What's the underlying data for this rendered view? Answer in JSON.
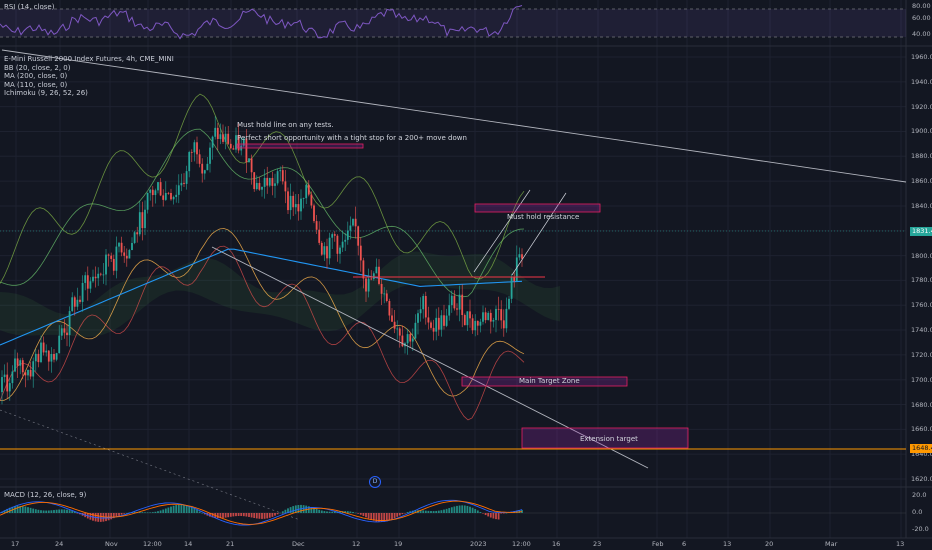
{
  "colors": {
    "background": "#131722",
    "grid": "#1e2230",
    "axis_text": "#b2b5be",
    "annotation_box": "#e91e63",
    "annotation_fill": "rgba(156,39,176,0.25)",
    "support_line": "#ff9800",
    "current_price": "#26a69a",
    "rsi_line": "#7e57c2",
    "bb_band": "#2962ff",
    "ma200": "#2196f3",
    "cloud_green": "#4caf50",
    "cloud_red": "#ef5350",
    "macd_line": "#2962ff",
    "signal_line": "#ff6d00"
  },
  "rsi": {
    "label": "RSI (14, close)",
    "ticks": [
      "80.00",
      "60.00",
      "40.00"
    ]
  },
  "legend": {
    "title": "E-Mini Russell 2000 Index Futures, 4h, CME_MINI",
    "lines": [
      "BB (20, close, 2, 0)",
      "MA (200, close, 0)",
      "MA (110, close, 0)",
      "Ichimoku (9, 26, 52, 26)"
    ]
  },
  "annotations": {
    "line1": "Must hold line on any tests.",
    "line2": "Perfect short opportunity with a tight stop for a 200+ move down",
    "resistance": "Must hold resistance",
    "main_target": "Main Target Zone",
    "extension": "Extension target",
    "event_badge": "D"
  },
  "price_axis": {
    "ticks": [
      "1960.0",
      "1940.0",
      "1920.0",
      "1900.0",
      "1880.0",
      "1860.0",
      "1840.0",
      "1820.0",
      "1800.0",
      "1780.0",
      "1760.0",
      "1740.0",
      "1720.0",
      "1700.0",
      "1680.0",
      "1660.0",
      "1640.0",
      "1620.0"
    ],
    "current_price": "1831.4",
    "support_price": "1648.4"
  },
  "macd": {
    "label": "MACD (12, 26, close, 9)",
    "ticks": [
      "20.0",
      "0.0",
      "-20.0"
    ]
  },
  "time_axis": {
    "ticks": [
      "17",
      "24",
      "Nov",
      "12:00",
      "14",
      "21",
      "Dec",
      "12",
      "19",
      "2023",
      "12:00",
      "16",
      "23",
      "Feb",
      "6",
      "13",
      "20",
      "Mar",
      "13"
    ]
  }
}
